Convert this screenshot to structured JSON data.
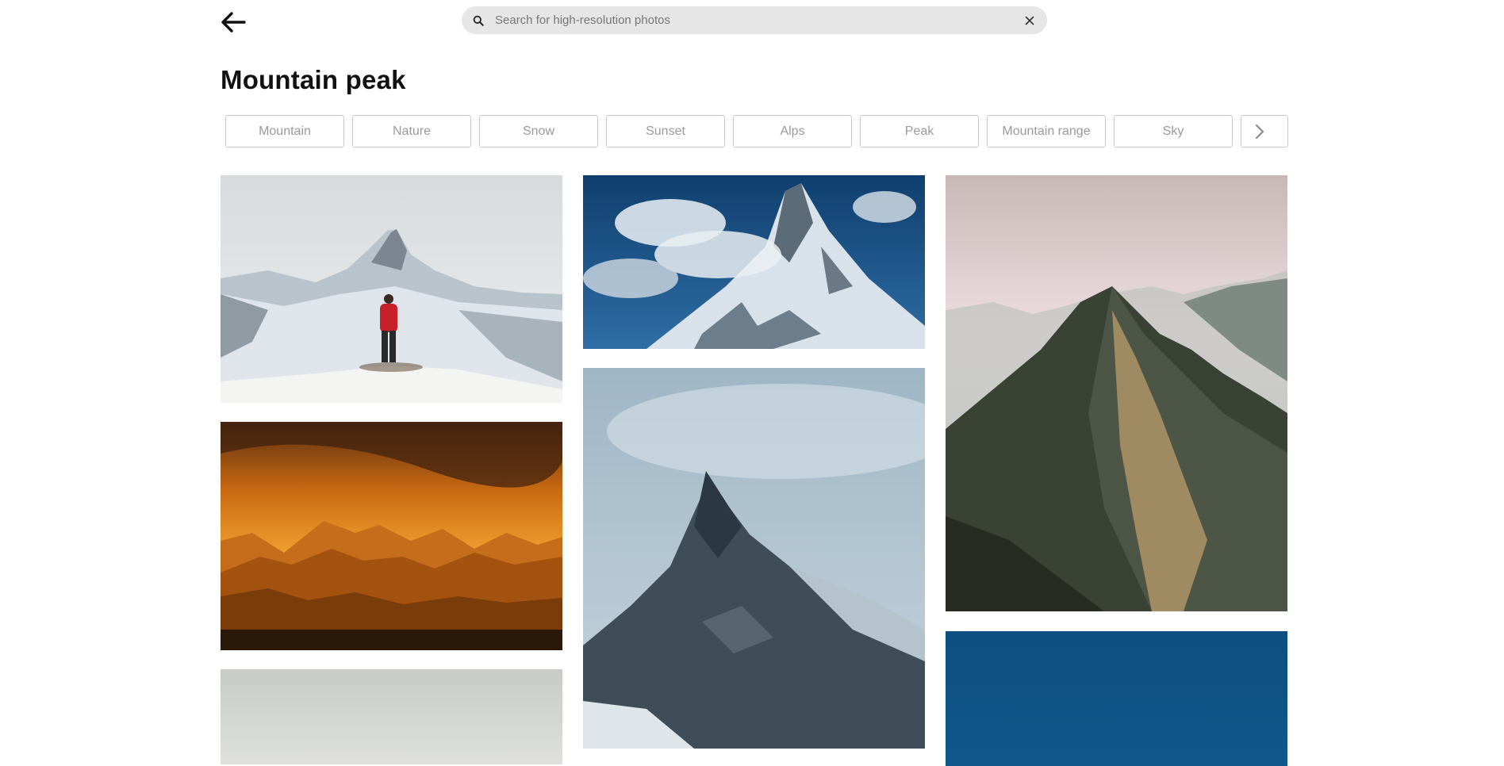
{
  "header": {
    "back_icon": "arrow-left-icon",
    "search": {
      "placeholder": "Search for high-resolution photos",
      "value": "",
      "search_icon": "magnifier-icon",
      "clear_icon": "close-icon"
    }
  },
  "page": {
    "title": "Mountain peak"
  },
  "tags": {
    "items": [
      "Mountain",
      "Nature",
      "Snow",
      "Sunset",
      "Alps",
      "Peak",
      "Mountain range",
      "Sky"
    ],
    "next_icon": "chevron-right-icon"
  },
  "photos": {
    "column1": [
      "hiker-red-jacket-matterhorn",
      "orange-sunset-mountain-silhouettes",
      "misty-grey-peak"
    ],
    "column2": [
      "snowy-peak-clouds-blue-sky",
      "dark-rocky-peak-cloudy"
    ],
    "column3": [
      "green-ridge-pink-sky",
      "deep-blue-sky"
    ]
  },
  "colors": {
    "search_bg": "#e6e6e6",
    "chip_border": "#c9c9c9",
    "chip_text": "#9a9a9a",
    "title": "#111111"
  }
}
